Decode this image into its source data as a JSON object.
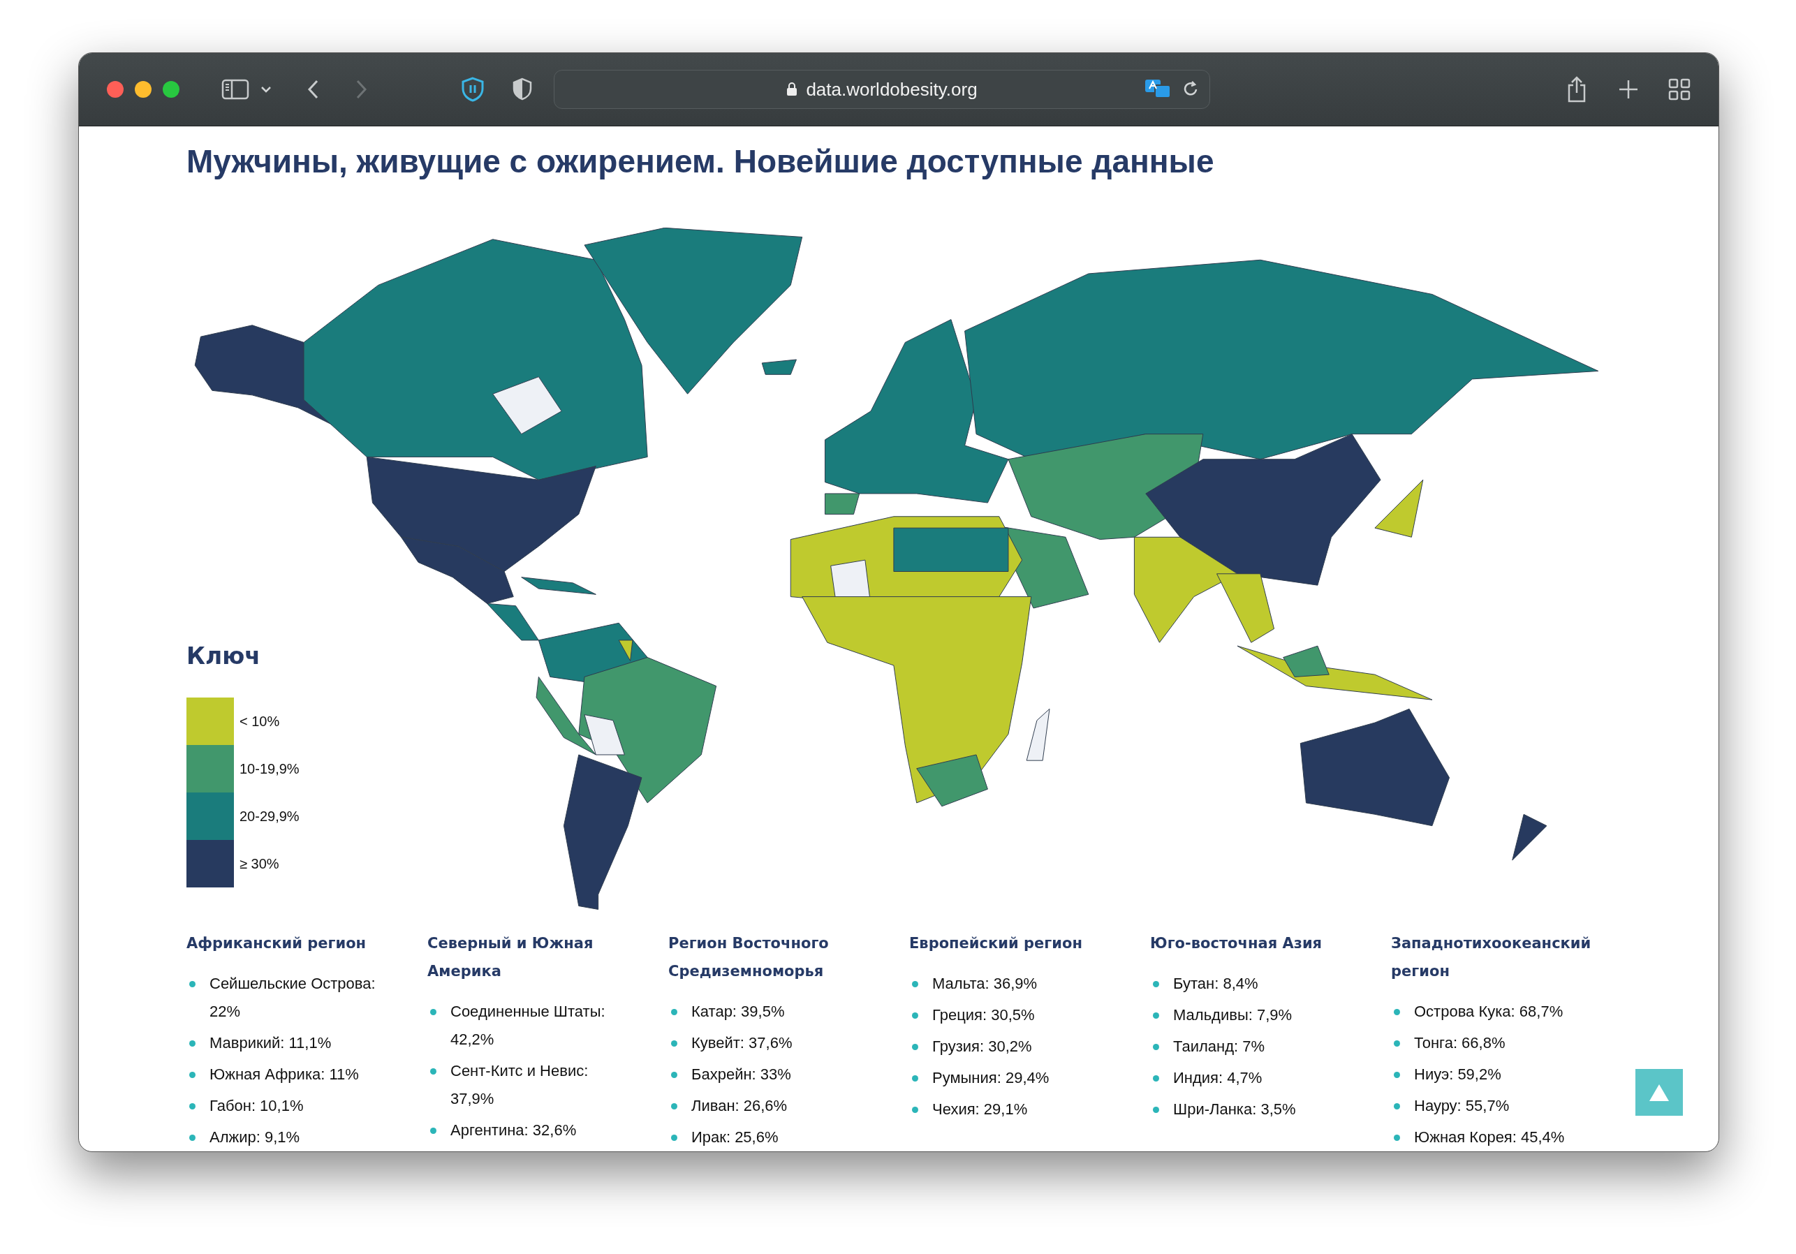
{
  "browser": {
    "url": "data.worldobesity.org"
  },
  "page": {
    "title": "Мужчины, живущие с ожирением. Новейшие доступные данные"
  },
  "legend": {
    "title": "Ключ",
    "items": [
      {
        "label": "< 10%",
        "color": "#bfca2e"
      },
      {
        "label": "10-19,9%",
        "color": "#41976c"
      },
      {
        "label": "20-29,9%",
        "color": "#1a7c7c"
      },
      {
        "label": "≥ 30%",
        "color": "#273a5f"
      }
    ]
  },
  "regions": [
    {
      "title": "Африканский регион",
      "items": [
        "Сейшельские Острова: 22%",
        "Маврикий: 11,1%",
        "Южная Африка: 11%",
        "Габон: 10,1%",
        "Алжир: 9,1%"
      ]
    },
    {
      "title": "Северный и Южная Америка",
      "items": [
        "Соединенные Штаты: 42,2%",
        "Сент-Китс и Невис: 37,9%",
        "Аргентина: 32,6%"
      ]
    },
    {
      "title": "Регион Восточного Средиземноморья",
      "items": [
        "Катар: 39,5%",
        "Кувейт: 37,6%",
        "Бахрейн: 33%",
        "Ливан: 26,6%",
        "Ирак: 25,6%"
      ]
    },
    {
      "title": "Европейский регион",
      "items": [
        "Мальта: 36,9%",
        "Греция: 30,5%",
        "Грузия: 30,2%",
        "Румыния: 29,4%",
        "Чехия: 29,1%"
      ]
    },
    {
      "title": "Юго-восточная Азия",
      "items": [
        "Бутан: 8,4%",
        "Мальдивы: 7,9%",
        "Таиланд: 7%",
        "Индия: 4,7%",
        "Шри-Ланка: 3,5%"
      ]
    },
    {
      "title": "Западнотихоокеанский регион",
      "items": [
        "Острова Кука: 68,7%",
        "Тонга: 66,8%",
        "Ниуэ: 59,2%",
        "Науру: 55,7%",
        "Южная Корея: 45,4%"
      ]
    }
  ]
}
